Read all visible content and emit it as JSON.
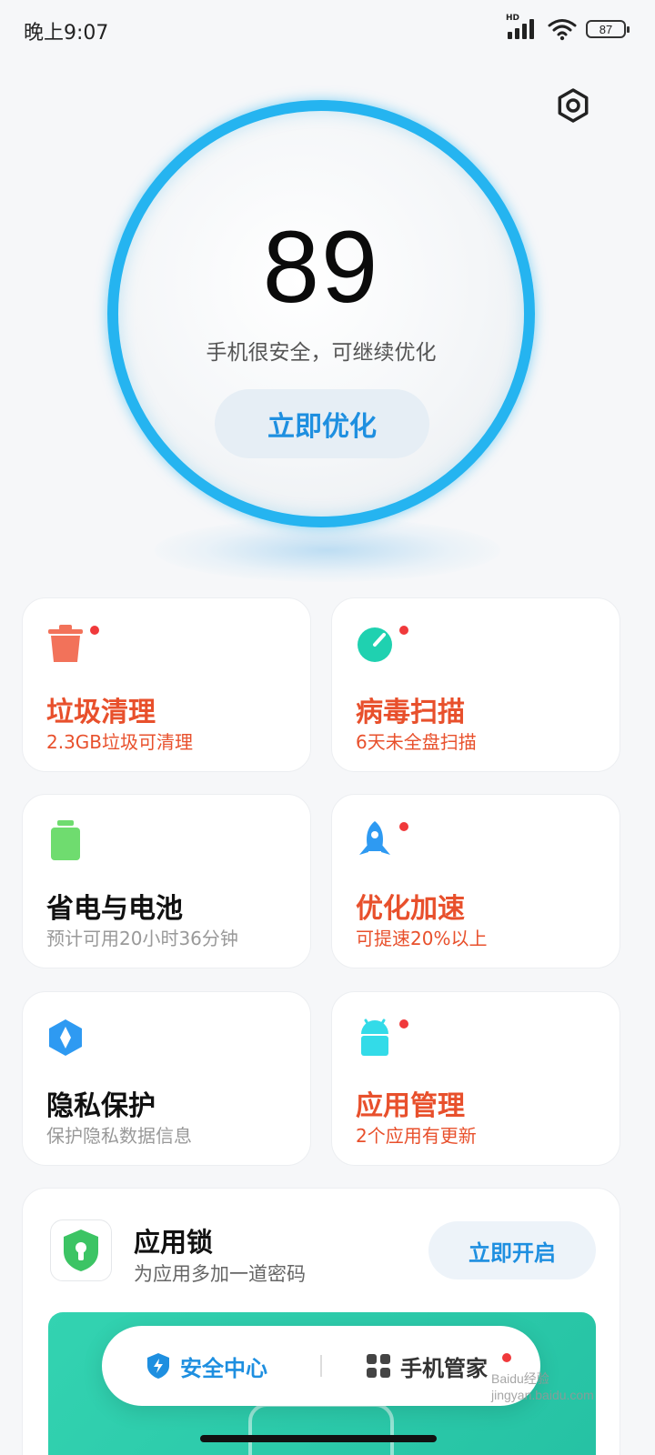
{
  "status_bar": {
    "time": "晚上9:07",
    "network_label": "HD",
    "battery": "87"
  },
  "score": {
    "value": "89",
    "subtitle": "手机很安全，可继续优化",
    "action": "立即优化",
    "ring_color": "#25b4f0"
  },
  "cards": [
    {
      "title": "垃圾清理",
      "desc": "2.3GB垃圾可清理",
      "icon": "trash-icon",
      "icon_color": "#f2725a",
      "alert": true
    },
    {
      "title": "病毒扫描",
      "desc": "6天未全盘扫描",
      "icon": "virus-scan-icon",
      "icon_color": "#1fd1b0",
      "alert": true
    },
    {
      "title": "省电与电池",
      "desc": "预计可用20小时36分钟",
      "icon": "battery-icon",
      "icon_color": "#6fdc6f",
      "alert": false
    },
    {
      "title": "优化加速",
      "desc": "可提速20%以上",
      "icon": "rocket-icon",
      "icon_color": "#2e9af2",
      "alert": true
    },
    {
      "title": "隐私保护",
      "desc": "保护隐私数据信息",
      "icon": "privacy-shield-icon",
      "icon_color": "#2e9af2",
      "alert": false
    },
    {
      "title": "应用管理",
      "desc": "2个应用有更新",
      "icon": "android-app-icon",
      "icon_color": "#33dbe8",
      "alert": true
    }
  ],
  "app_lock": {
    "title": "应用锁",
    "desc": "为应用多加一道密码",
    "action": "立即开启",
    "banner_color": "#2ec9aa"
  },
  "tabs": {
    "security": "安全中心",
    "manager": "手机管家"
  },
  "watermark": "Baidu经验 jingyan.baidu.com",
  "colors": {
    "accent": "#1e8fe0",
    "alert": "#e8502c",
    "badge": "#f0393b"
  }
}
